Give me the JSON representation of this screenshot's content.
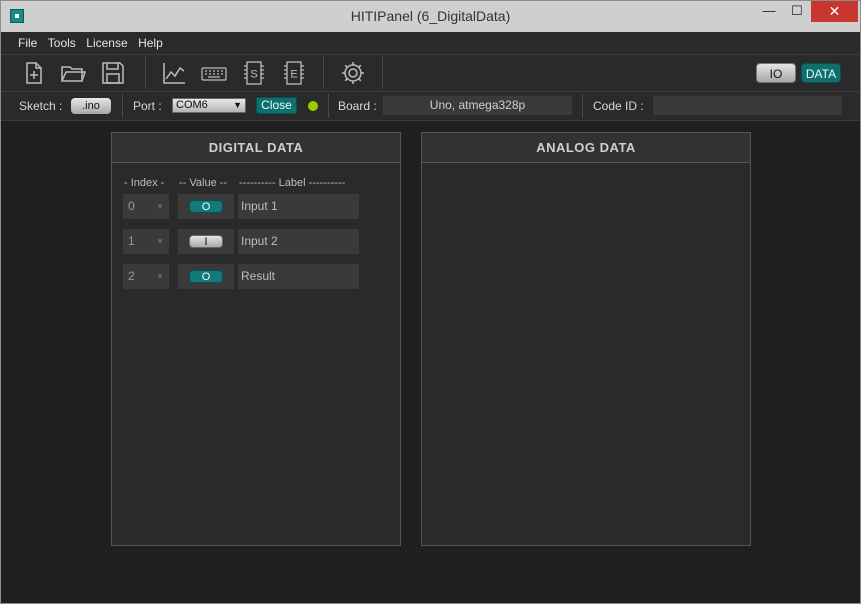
{
  "window": {
    "title": "HITIPanel     (6_DigitalData)",
    "minimize_glyph": "—",
    "maximize_glyph": "☐",
    "close_glyph": "✕"
  },
  "menu": [
    "File",
    "Tools",
    "License",
    "Help"
  ],
  "toolbar": {
    "icons": [
      "new-file-icon",
      "open-folder-icon",
      "save-icon",
      "chart-icon",
      "keyboard-icon",
      "serial-s-icon",
      "eeprom-e-icon",
      "settings-gear-icon"
    ],
    "mode_io": "IO",
    "mode_data": "DATA"
  },
  "status": {
    "sketch_label": "Sketch :",
    "sketch_button": ".ino",
    "port_label": "Port :",
    "port_value": "COM6",
    "close_button": "Close",
    "board_label": "Board :",
    "board_value": "Uno, atmega328p",
    "code_id_label": "Code ID :",
    "code_id_value": "",
    "led_color": "#9acd00"
  },
  "digital": {
    "title": "DIGITAL  DATA",
    "headers": {
      "index": "- Index -",
      "value": "-- Value --",
      "label": "---------- Label ----------"
    },
    "rows": [
      {
        "index": "0",
        "value": "O",
        "state": "off",
        "label": "Input 1"
      },
      {
        "index": "1",
        "value": "I",
        "state": "on",
        "label": "Input 2"
      },
      {
        "index": "2",
        "value": "O",
        "state": "off",
        "label": "Result"
      }
    ]
  },
  "analog": {
    "title": "ANALOG  DATA"
  },
  "colors": {
    "accent_teal": "#0f6f6f",
    "background": "#1f1f1f",
    "panel": "#2a2a2a"
  }
}
